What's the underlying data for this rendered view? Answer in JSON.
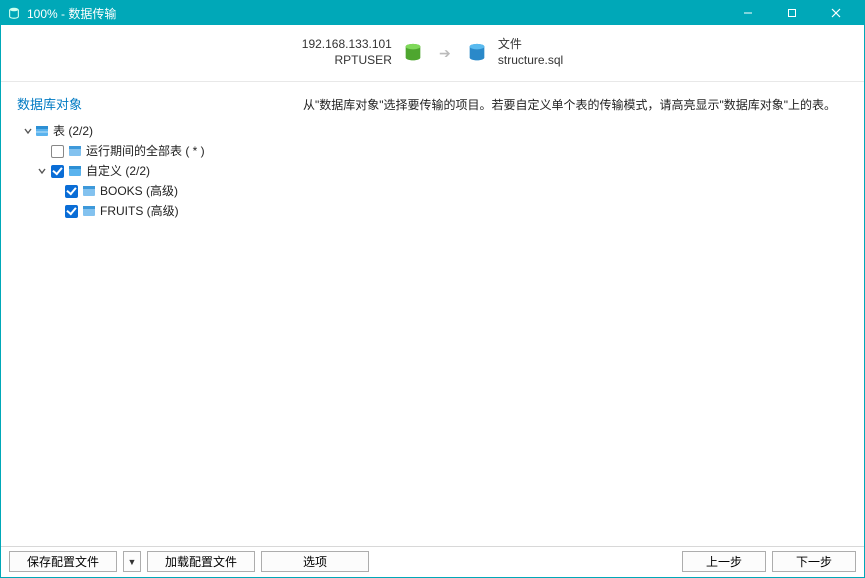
{
  "titlebar": {
    "title": "100% - 数据传输"
  },
  "conn": {
    "source_host": "192.168.133.101",
    "source_user": "RPTUSER",
    "target_label": "文件",
    "target_file": "structure.sql"
  },
  "left": {
    "section_title": "数据库对象",
    "tree": {
      "tables_label": "表 (2/2)",
      "runtime_label": "运行期间的全部表 ( * )",
      "custom_label": "自定义 (2/2)",
      "books_label": "BOOKS (高级)",
      "fruits_label": "FRUITS (高级)"
    }
  },
  "right": {
    "instruction": "从\"数据库对象\"选择要传输的项目。若要自定义单个表的传输模式，请高亮显示\"数据库对象\"上的表。"
  },
  "bottom": {
    "save_profile": "保存配置文件",
    "load_profile": "加载配置文件",
    "options": "选项",
    "prev": "上一步",
    "next": "下一步"
  }
}
